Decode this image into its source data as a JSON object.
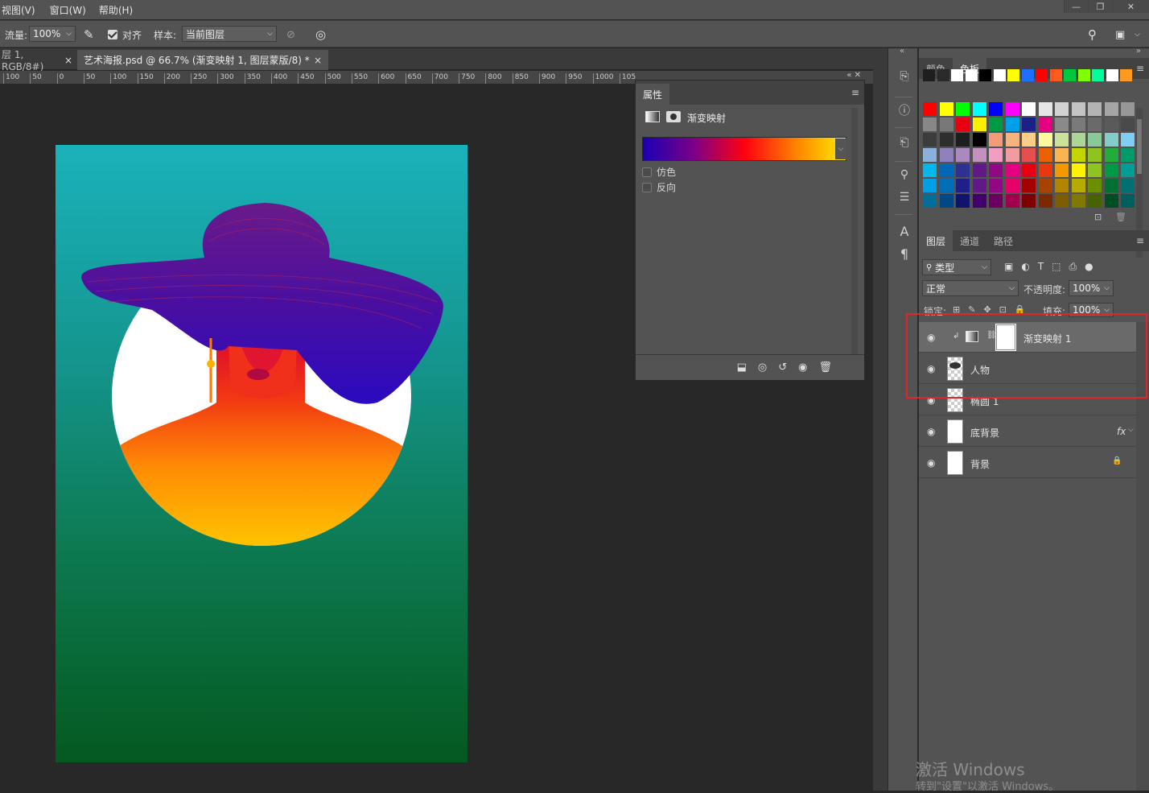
{
  "menubar": {
    "items": [
      "视图(V)",
      "窗口(W)",
      "帮助(H)"
    ],
    "controls": [
      "—",
      "❐",
      "✕"
    ]
  },
  "options": {
    "flow_label": "流量:",
    "flow_value": "100%",
    "align_label": "对齐",
    "align_checked": true,
    "sample_label": "样本:",
    "sample_value": "当前图层"
  },
  "tabs": [
    {
      "label": "层 1, RGB/8#)",
      "close": "×"
    },
    {
      "label": "艺术海报.psd @ 66.7% (渐变映射 1, 图层蒙版/8) *",
      "close": "×"
    }
  ],
  "ruler": [
    "100",
    "50",
    "0",
    "50",
    "100",
    "150",
    "200",
    "250",
    "300",
    "350",
    "400",
    "450",
    "500",
    "550",
    "600",
    "650",
    "700",
    "750",
    "800",
    "850",
    "900",
    "950",
    "1000",
    "105"
  ],
  "properties": {
    "title": "属性",
    "layer_type": "渐变映射",
    "dither_label": "仿色",
    "dither_checked": false,
    "reverse_label": "反向",
    "reverse_checked": false
  },
  "swatches_panel": {
    "tabs": [
      "颜色",
      "色板"
    ],
    "active": "色板"
  },
  "swatch_colors": [
    [
      "#1e1e1e",
      "#2a2a2a",
      "#ffffff",
      "#ffffff",
      "#000000",
      "#ffffff",
      "#ffff00",
      "#1e6fff",
      "#ff0000",
      "#ff5a1e",
      "#00c83c",
      "#7fff00",
      "#00ff9a",
      "#ffffff",
      "#ff9a1e"
    ],
    [
      "#ff0000",
      "#ffff00",
      "#00ff00",
      "#00ffff",
      "#0000ff",
      "#ff00ff",
      "#ffffff",
      "#e6e6e6",
      "#d2d2d2",
      "#c3c3c3",
      "#b4b4b4",
      "#a5a5a5",
      "#969696"
    ],
    [
      "#878787",
      "#787878",
      "#e60012",
      "#fff000",
      "#009944",
      "#00a0e9",
      "#1d2088",
      "#e4007f",
      "#8a8a8a",
      "#7a7a7a",
      "#6a6a6a",
      "#5a5a5a",
      "#4a4a4a"
    ],
    [
      "#3c3c3c",
      "#2e2e2e",
      "#1e1e1e",
      "#000000",
      "#f29b76",
      "#f6b37f",
      "#facd89",
      "#fff799",
      "#cce198",
      "#acd598",
      "#89c997",
      "#84ccc9",
      "#7ecef4"
    ],
    [
      "#8ab1db",
      "#8f82bc",
      "#aa89bd",
      "#c490bf",
      "#f19ec2",
      "#f29c9f",
      "#e5504f",
      "#eb6100",
      "#f8b551",
      "#c3d600",
      "#8fc31f",
      "#22ac38",
      "#009b6b"
    ],
    [
      "#00b7ee",
      "#0068b7",
      "#2e3192",
      "#601986",
      "#920783",
      "#e4007f",
      "#e60012",
      "#e8380d",
      "#f39800",
      "#fff100",
      "#8fc31f",
      "#009944",
      "#009e96"
    ],
    [
      "#00a0e9",
      "#036eb8",
      "#1d2088",
      "#601986",
      "#920783",
      "#e5006a",
      "#a40000",
      "#a84200",
      "#b28500",
      "#b7aa00",
      "#6a8f00",
      "#007130",
      "#007075"
    ],
    [
      "#006f9c",
      "#004986",
      "#10146c",
      "#43006c",
      "#6b005f",
      "#a1004f",
      "#7d0000",
      "#7b2900",
      "#7d5d00",
      "#807800",
      "#476300",
      "#004e21",
      "#005e5f"
    ]
  ],
  "layers_panel": {
    "tabs": [
      "图层",
      "通道",
      "路径"
    ],
    "filter_label": "类型",
    "blend_mode": "正常",
    "opacity_label": "不透明度:",
    "opacity_value": "100%",
    "lock_label": "锁定:",
    "fill_label": "填充:",
    "fill_value": "100%",
    "layers": [
      {
        "name": "渐变映射 1",
        "selected": true
      },
      {
        "name": "人物",
        "selected": false
      },
      {
        "name": "椭圆 1",
        "selected": false
      },
      {
        "name": "底背景",
        "selected": false,
        "fx": "fx"
      },
      {
        "name": "背景",
        "selected": false,
        "locked": true
      }
    ]
  },
  "watermark": {
    "line1": "激活 Windows",
    "line2": "转到\"设置\"以激活 Windows。"
  }
}
